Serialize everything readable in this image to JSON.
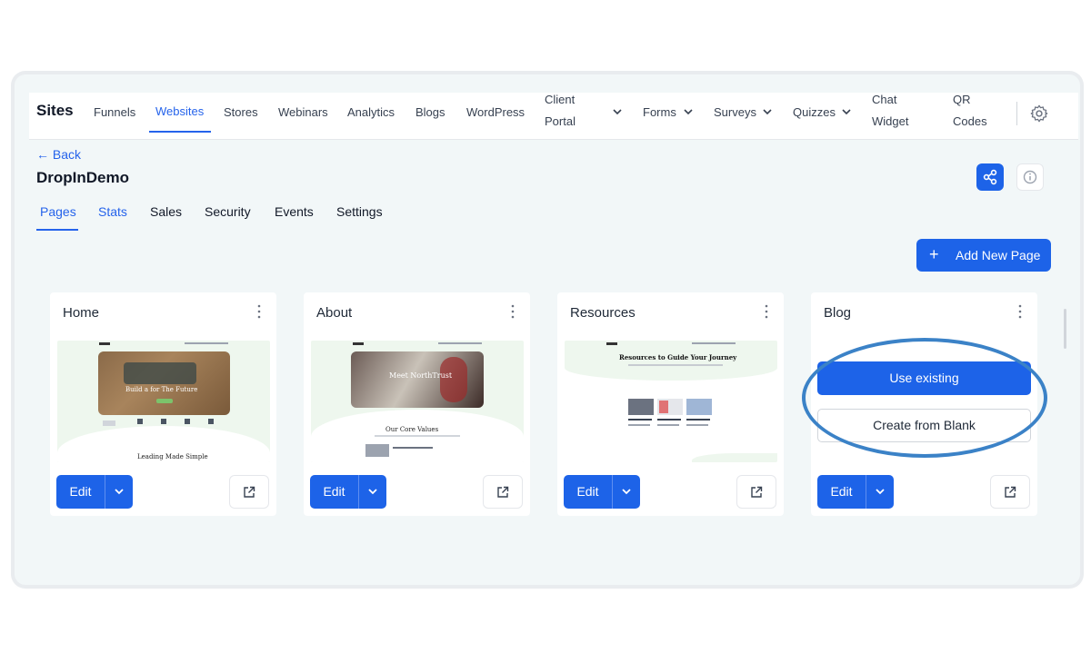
{
  "app": {
    "title": "Sites"
  },
  "nav": {
    "items": [
      "Funnels",
      "Websites",
      "Stores",
      "Webinars",
      "Analytics",
      "Blogs",
      "WordPress"
    ],
    "client_portal": [
      "Client",
      "Portal"
    ],
    "dropdowns": [
      "Forms",
      "Surveys",
      "Quizzes"
    ],
    "chat_widget": [
      "Chat",
      "Widget"
    ],
    "qr_codes": [
      "QR",
      "Codes"
    ],
    "active": "Websites"
  },
  "header": {
    "back": "← Back",
    "site_name": "DropInDemo"
  },
  "subtabs": [
    "Pages",
    "Stats",
    "Sales",
    "Security",
    "Events",
    "Settings"
  ],
  "actions": {
    "add_new_page": "Add New Page"
  },
  "pages": [
    {
      "title": "Home",
      "thumb": {
        "hero": "Build a        for The Future",
        "footer": "Leading Made Simple"
      }
    },
    {
      "title": "About",
      "thumb": {
        "hero": "Meet NorthTrust",
        "footer": "Our Core Values"
      }
    },
    {
      "title": "Resources",
      "thumb": {
        "hero": "Resources to Guide Your Journey"
      }
    },
    {
      "title": "Blog"
    }
  ],
  "buttons": {
    "edit": "Edit",
    "use_existing": "Use existing",
    "create_from_blank": "Create from Blank"
  },
  "colors": {
    "accent": "#1d63e8",
    "ring": "#3b82c7",
    "background": "#f2f7f8"
  }
}
